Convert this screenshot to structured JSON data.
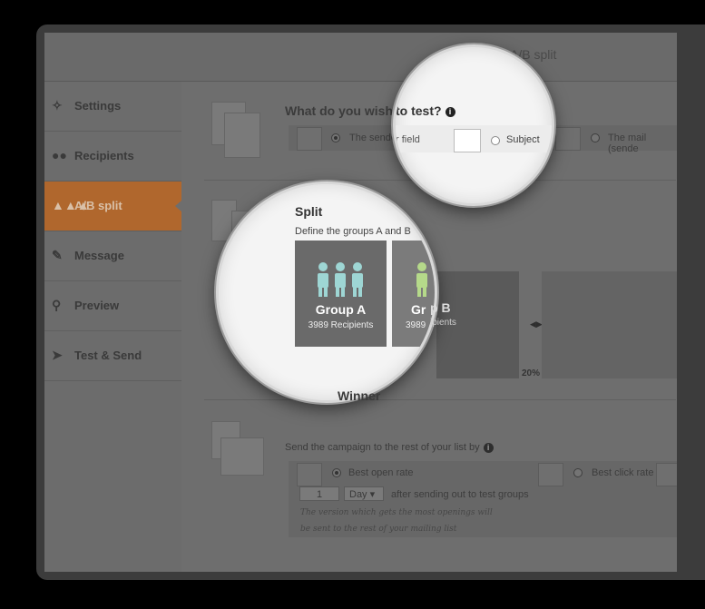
{
  "window": {
    "title": "A/B split"
  },
  "sidebar": {
    "items": [
      {
        "label": "Settings",
        "icon": "settings-tools-icon"
      },
      {
        "label": "Recipients",
        "icon": "users-icon"
      },
      {
        "label": "A/B split",
        "icon": "people-group-icon",
        "active": true
      },
      {
        "label": "Message",
        "icon": "edit-icon"
      },
      {
        "label": "Preview",
        "icon": "preview-icon"
      },
      {
        "label": "Test & Send",
        "icon": "paper-plane-icon"
      }
    ]
  },
  "test_section": {
    "heading_left": "What do you wish",
    "heading_right": "to test?",
    "options": [
      {
        "label": "The sender",
        "label_suffix": "r field",
        "selected": true
      },
      {
        "label": "Subject",
        "selected": false
      },
      {
        "label": "The mail (sende",
        "selected": false
      }
    ]
  },
  "split_section": {
    "heading": "Split",
    "subtitle": "Define the groups A and B",
    "group_a": {
      "name": "Group A",
      "recipients": "3989 Recipients"
    },
    "group_b": {
      "name_left": "Gr",
      "name_right": "p B",
      "recipients_left": "3989",
      "recipients_right": "ipients"
    },
    "percent": "20%"
  },
  "winner_section": {
    "heading": "Winner",
    "subtitle": "Send the campaign to the rest of your list by",
    "options": [
      {
        "label": "Best open rate",
        "selected": true
      },
      {
        "label": "Best click rate",
        "selected": false
      }
    ],
    "count_value": "1",
    "unit_value": "Day",
    "after_text": "after sending out to test groups",
    "note_line1": "The version which gets the most openings will",
    "note_line2": "be sent to the rest of your mailing list"
  },
  "colors": {
    "accent": "#b0672d",
    "people_teal": "#9ed6d4",
    "people_green": "#b5d98a"
  }
}
